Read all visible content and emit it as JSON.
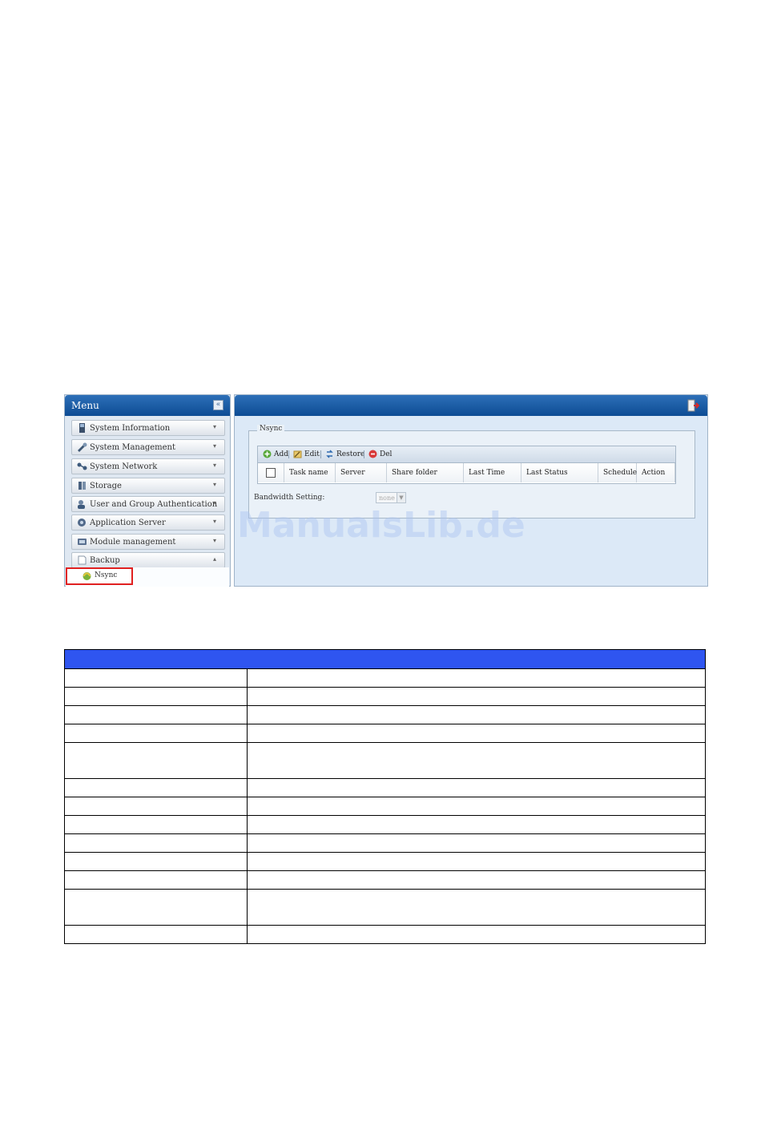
{
  "menu": {
    "title": "Menu",
    "items": [
      {
        "label": "System Information",
        "icon": "info-icon"
      },
      {
        "label": "System Management",
        "icon": "wrench-icon"
      },
      {
        "label": "System Network",
        "icon": "network-icon"
      },
      {
        "label": "Storage",
        "icon": "storage-icon"
      },
      {
        "label": "User and Group Authentication",
        "icon": "users-icon"
      },
      {
        "label": "Application Server",
        "icon": "server-icon"
      },
      {
        "label": "Module management",
        "icon": "module-icon"
      },
      {
        "label": "Backup",
        "icon": "backup-icon"
      }
    ],
    "subitem": {
      "label": "Nsync",
      "icon": "nsync-icon"
    }
  },
  "content": {
    "group_title": "Nsync",
    "toolbar": {
      "add": "Add",
      "edit": "Edit",
      "restore": "Restore",
      "del": "Del"
    },
    "columns": [
      "Task name",
      "Server",
      "Share folder",
      "Last Time",
      "Last Status",
      "Schedule",
      "Action"
    ],
    "bandwidth_label": "Bandwidth Setting:",
    "bandwidth_value": "none"
  },
  "watermark": "ManualsLib.de",
  "description_table": {
    "row_count": 13
  }
}
